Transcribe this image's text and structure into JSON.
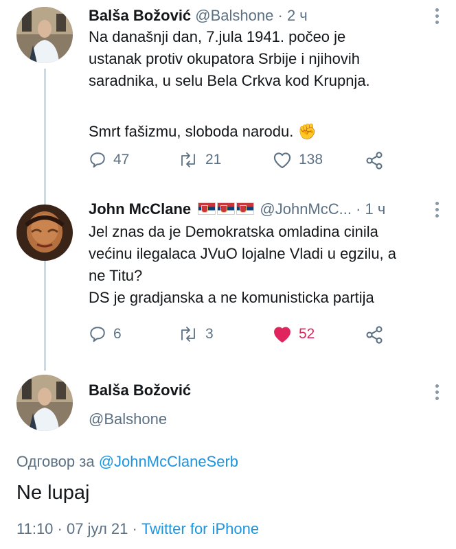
{
  "tweet1": {
    "name": "Balša Božović",
    "handle": "@Balshone",
    "time": "· 2 ч",
    "lines": [
      "Na današnji dan, 7.jula 1941. počeo je",
      "ustanak protiv okupatora Srbije i njihovih",
      "saradnika, u selu Bela Crkva kod Krupnja.",
      "",
      "Smrt fašizmu, sloboda narodu. ✊"
    ],
    "replies": "47",
    "retweets": "21",
    "likes": "138",
    "liked": false
  },
  "tweet2": {
    "name": "John McClane",
    "handle": "@JohnMcC...",
    "time": "· 1 ч",
    "lines": [
      "Jel znas da je Demokratska omladina cinila",
      "većinu ilegalaca JVuO lojalne Vladi u egzilu, a",
      "ne Titu?",
      "DS je gradjanska a ne komunisticka partija"
    ],
    "replies": "6",
    "retweets": "3",
    "likes": "52",
    "liked": true
  },
  "tweet3": {
    "name": "Balša Božović",
    "handle": "@Balshone",
    "reply_prefix": "Одговор за ",
    "reply_to": "@JohnMcClaneSerb",
    "text": "Ne lupaj",
    "time": "11:10 · 07 јул 21 · ",
    "source": "Twitter for iPhone"
  },
  "icons": {
    "reply": "reply-icon",
    "retweet": "retweet-icon",
    "like": "heart-icon",
    "share": "share-icon",
    "more": "more-icon",
    "flag": "serbian-flag-icon"
  },
  "colors": {
    "like_active": "#e0245e",
    "link": "#1b95e0",
    "muted": "#5b7083",
    "thread_line": "#cfd9de"
  }
}
